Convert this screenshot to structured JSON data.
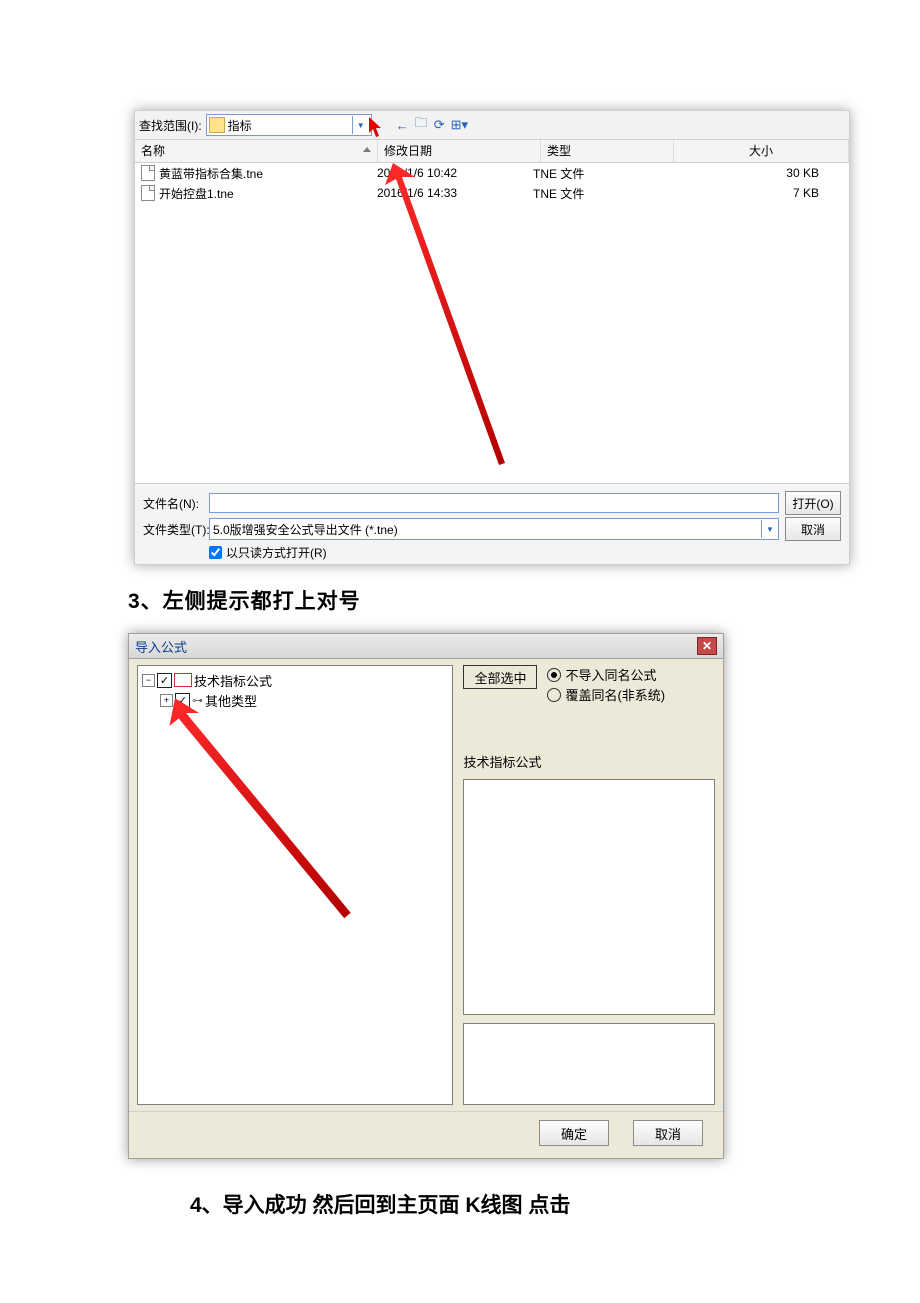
{
  "file_dialog": {
    "lookin_label": "查找范围(I):",
    "lookin_value": "指标",
    "toolbar": {
      "back": "←",
      "up": "🗀",
      "new": "⟳",
      "view": "⊞▾"
    },
    "headers": {
      "name": "名称",
      "date": "修改日期",
      "type": "类型",
      "size": "大小"
    },
    "rows": [
      {
        "name": "黄蓝带指标合集.tne",
        "date": "2016/1/6 10:42",
        "type": "TNE 文件",
        "size": "30 KB"
      },
      {
        "name": "开始控盘1.tne",
        "date": "2016/1/6 14:33",
        "type": "TNE 文件",
        "size": "7 KB"
      }
    ],
    "filename_label": "文件名(N):",
    "filename_value": "",
    "filetype_label": "文件类型(T):",
    "filetype_value": "5.0版增强安全公式导出文件 (*.tne)",
    "open_btn": "打开(O)",
    "cancel_btn": "取消",
    "readonly_label": "以只读方式打开(R)"
  },
  "step3_caption": "3、左侧提示都打上对号",
  "import_dialog": {
    "title": "导入公式",
    "tree_root": "技术指标公式",
    "tree_child": "其他类型",
    "select_all": "全部选中",
    "radio1": "不导入同名公式",
    "radio2": "覆盖同名(非系统)",
    "group_label": "技术指标公式",
    "ok_btn": "确定",
    "cancel_btn": "取消"
  },
  "step4_caption": "4、导入成功 然后回到主页面 K线图 点击"
}
